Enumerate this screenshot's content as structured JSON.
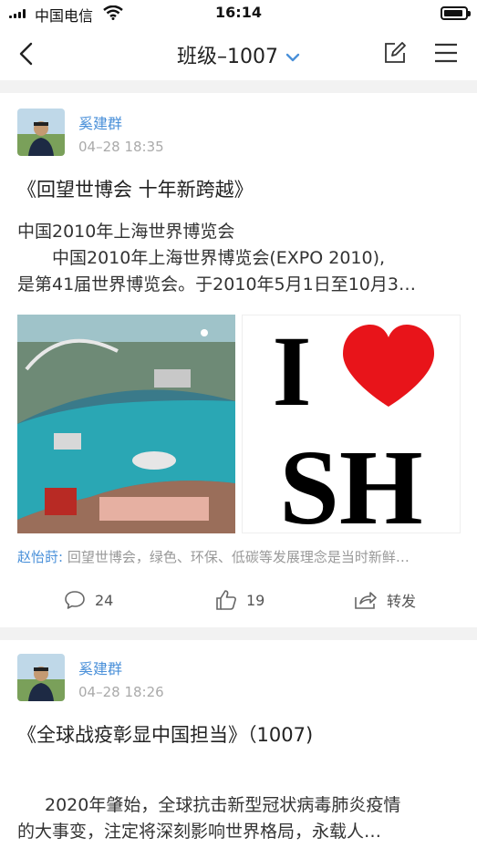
{
  "status_bar": {
    "carrier": "中国电信",
    "time": "16:14",
    "battery_level": 0.9
  },
  "nav": {
    "title": "班级–1007"
  },
  "posts": [
    {
      "author": "奚建群",
      "time": "04–28 18:35",
      "title": "《回望世博会   十年新跨越》",
      "body": [
        "中国2010年上海世界博览会",
        "中国2010年上海世界博览会(EXPO 2010),",
        "是第41届世界博览会。于2010年5月1日至10月3…"
      ],
      "images": [
        "expo-aerial-map",
        "i-love-sh"
      ],
      "comment": {
        "user": "赵怡莳:",
        "text": "回望世博会，绿色、环保、低碳等发展理念是当时新鲜…"
      },
      "comment_count": "24",
      "like_count": "19",
      "share_label": "转发"
    },
    {
      "author": "奚建群",
      "time": "04–28 18:26",
      "title": "《全球战疫彰显中国担当》（1007)",
      "body": [
        "2020年肇始，全球抗击新型冠状病毒肺炎疫情",
        "的大事变，注定将深刻影响世界格局，永载人…"
      ]
    }
  ],
  "i_love_sh": {
    "top": "I",
    "bottom": "SH"
  },
  "colors": {
    "accent": "#4a90d9",
    "heart": "#e8141a"
  }
}
